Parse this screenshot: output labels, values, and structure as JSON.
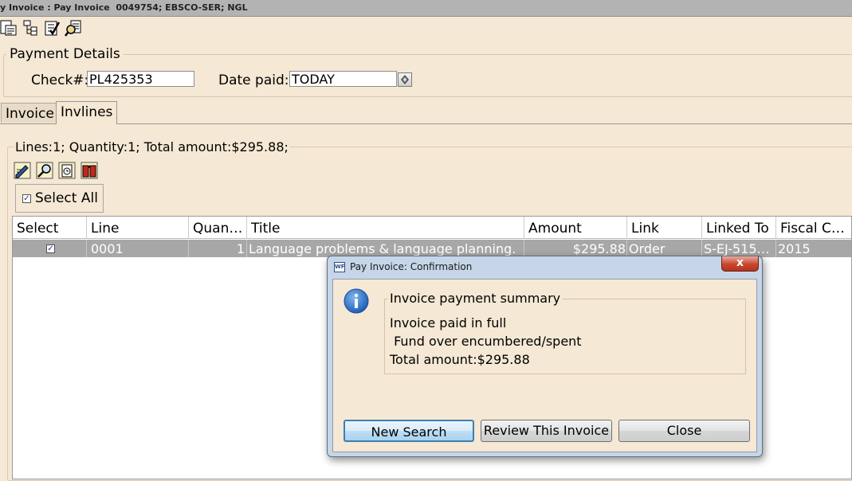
{
  "window": {
    "title": "y Invoice : Pay Invoice  0049754; EBSCO-SER; NGL"
  },
  "toolbar": {
    "icons": [
      "paste-icon",
      "tree-icon",
      "checklist-icon",
      "search-document-icon"
    ]
  },
  "payment_details": {
    "legend": "Payment Details",
    "check_label": "Check#:",
    "check_value": "PL425353",
    "date_label": "Date paid:",
    "date_value": "TODAY"
  },
  "tabs": [
    {
      "label": "Invoice",
      "active": false
    },
    {
      "label": "Invlines",
      "active": true
    }
  ],
  "invlines": {
    "summary": "Lines:1; Quantity:1; Total amount:$295.88;",
    "icons": [
      "edit-line-icon",
      "search-line-icon",
      "clock-icon",
      "book-icon"
    ],
    "select_all_label": "Select All",
    "select_all_checked": true
  },
  "grid": {
    "columns": [
      "Select",
      "Line",
      "Quan…",
      "Title",
      "Amount",
      "Link",
      "Linked To",
      "Fiscal C…"
    ],
    "rows": [
      {
        "selected": true,
        "line": "0001",
        "quantity": "1",
        "title": "Language problems & language planning.",
        "amount": "$295.88",
        "link": "Order",
        "linked_to": "S-EJ-515…",
        "fiscal_cycle": "2015"
      }
    ]
  },
  "dialog": {
    "app_badge": "WF",
    "title": "Pay Invoice: Confirmation",
    "close_glyph": "x",
    "legend": "Invoice payment summary",
    "lines": [
      "Invoice paid in full",
      " Fund over encumbered/spent",
      "Total amount:$295.88"
    ],
    "buttons": {
      "new_search": "New Search",
      "review": "Review This Invoice",
      "close": "Close"
    }
  },
  "colors": {
    "background": "#f5e8d4",
    "row_selected": "#a7a7a7",
    "dialog_frame": "#c6d6e8",
    "close_red": "#c9452e",
    "info_blue": "#1f5fb8"
  }
}
